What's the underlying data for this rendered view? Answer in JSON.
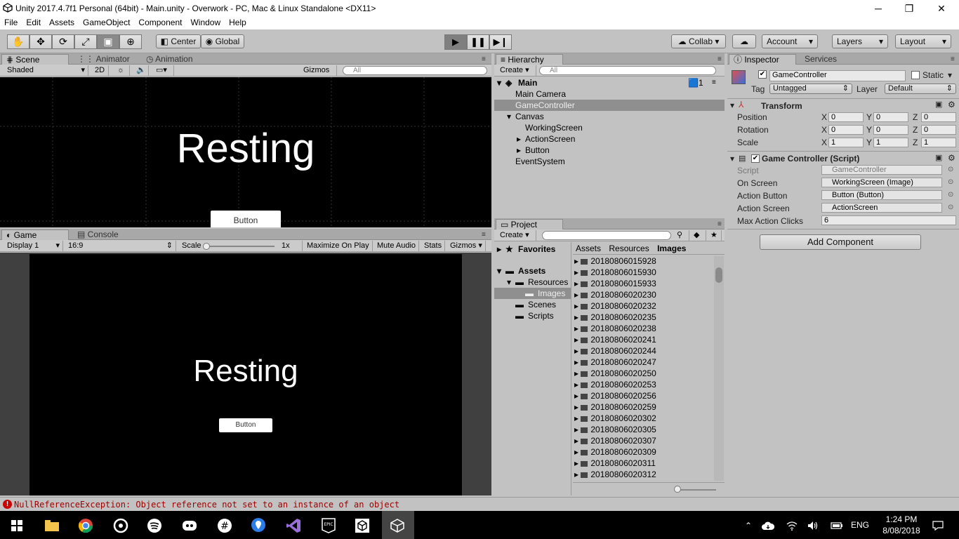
{
  "window": {
    "title": "Unity 2017.4.7f1 Personal (64bit) - Main.unity - Overwork - PC, Mac & Linux Standalone <DX11>",
    "minimize": "─",
    "maximize": "❐",
    "close": "✕"
  },
  "menu": [
    "File",
    "Edit",
    "Assets",
    "GameObject",
    "Component",
    "Window",
    "Help"
  ],
  "toolbar": {
    "center": "Center",
    "global": "Global",
    "collab": "Collab ▾",
    "account": "Account",
    "layers": "Layers",
    "layout": "Layout"
  },
  "scene": {
    "tab_scene": "Scene",
    "tab_animator": "Animator",
    "tab_animation": "Animation",
    "shaded": "Shaded",
    "mode2d": "2D",
    "gizmos": "Gizmos",
    "search_placeholder": "All",
    "label": "Resting",
    "button": "Button"
  },
  "game": {
    "tab_game": "Game",
    "tab_console": "Console",
    "display": "Display 1",
    "aspect": "16:9",
    "scale_label": "Scale",
    "scale_value": "1x",
    "maximize": "Maximize On Play",
    "mute": "Mute Audio",
    "stats": "Stats",
    "gizmos": "Gizmos",
    "label": "Resting",
    "button": "Button"
  },
  "hierarchy": {
    "tab": "Hierarchy",
    "create": "Create",
    "search_placeholder": "All",
    "scene_name": "Main",
    "scene_count": "1",
    "items": [
      "Main Camera",
      "GameController",
      "Canvas",
      "WorkingScreen",
      "ActionScreen",
      "Button",
      "EventSystem"
    ]
  },
  "project": {
    "tab": "Project",
    "create": "Create",
    "favorites": "Favorites",
    "assets": "Assets",
    "resources": "Resources",
    "images": "Images",
    "scenes": "Scenes",
    "scripts": "Scripts",
    "breadcrumb": [
      "Assets",
      "Resources",
      "Images"
    ],
    "files": [
      "20180806015928",
      "20180806015930",
      "20180806015933",
      "20180806020230",
      "20180806020232",
      "20180806020235",
      "20180806020238",
      "20180806020241",
      "20180806020244",
      "20180806020247",
      "20180806020250",
      "20180806020253",
      "20180806020256",
      "20180806020259",
      "20180806020302",
      "20180806020305",
      "20180806020307",
      "20180806020309",
      "20180806020311",
      "20180806020312"
    ]
  },
  "inspector": {
    "tab": "Inspector",
    "tab_services": "Services",
    "object_name": "GameController",
    "static": "Static",
    "tag_label": "Tag",
    "tag_value": "Untagged",
    "layer_label": "Layer",
    "layer_value": "Default",
    "transform": "Transform",
    "position": "Position",
    "rotation": "Rotation",
    "scale": "Scale",
    "pos": [
      "0",
      "0",
      "0"
    ],
    "rot": [
      "0",
      "0",
      "0"
    ],
    "scl": [
      "1",
      "1",
      "1"
    ],
    "x": "X",
    "y": "Y",
    "z": "Z",
    "script_component": "Game Controller (Script)",
    "script_label": "Script",
    "script_value": "GameController",
    "on_screen_label": "On Screen",
    "on_screen_value": "WorkingScreen (Image)",
    "action_button_label": "Action Button",
    "action_button_value": "Button (Button)",
    "action_screen_label": "Action Screen",
    "action_screen_value": "ActionScreen",
    "max_clicks_label": "Max Action Clicks",
    "max_clicks_value": "6",
    "add_component": "Add Component"
  },
  "status": {
    "error": "NullReferenceException: Object reference not set to an instance of an object"
  },
  "taskbar": {
    "lang": "ENG",
    "time": "1:24 PM",
    "date": "8/08/2018"
  },
  "colors": {
    "scene_bg": "#000000",
    "panel": "#c2c2c2",
    "selected_row": "#8f8f8f",
    "error_text": "#a00000"
  }
}
